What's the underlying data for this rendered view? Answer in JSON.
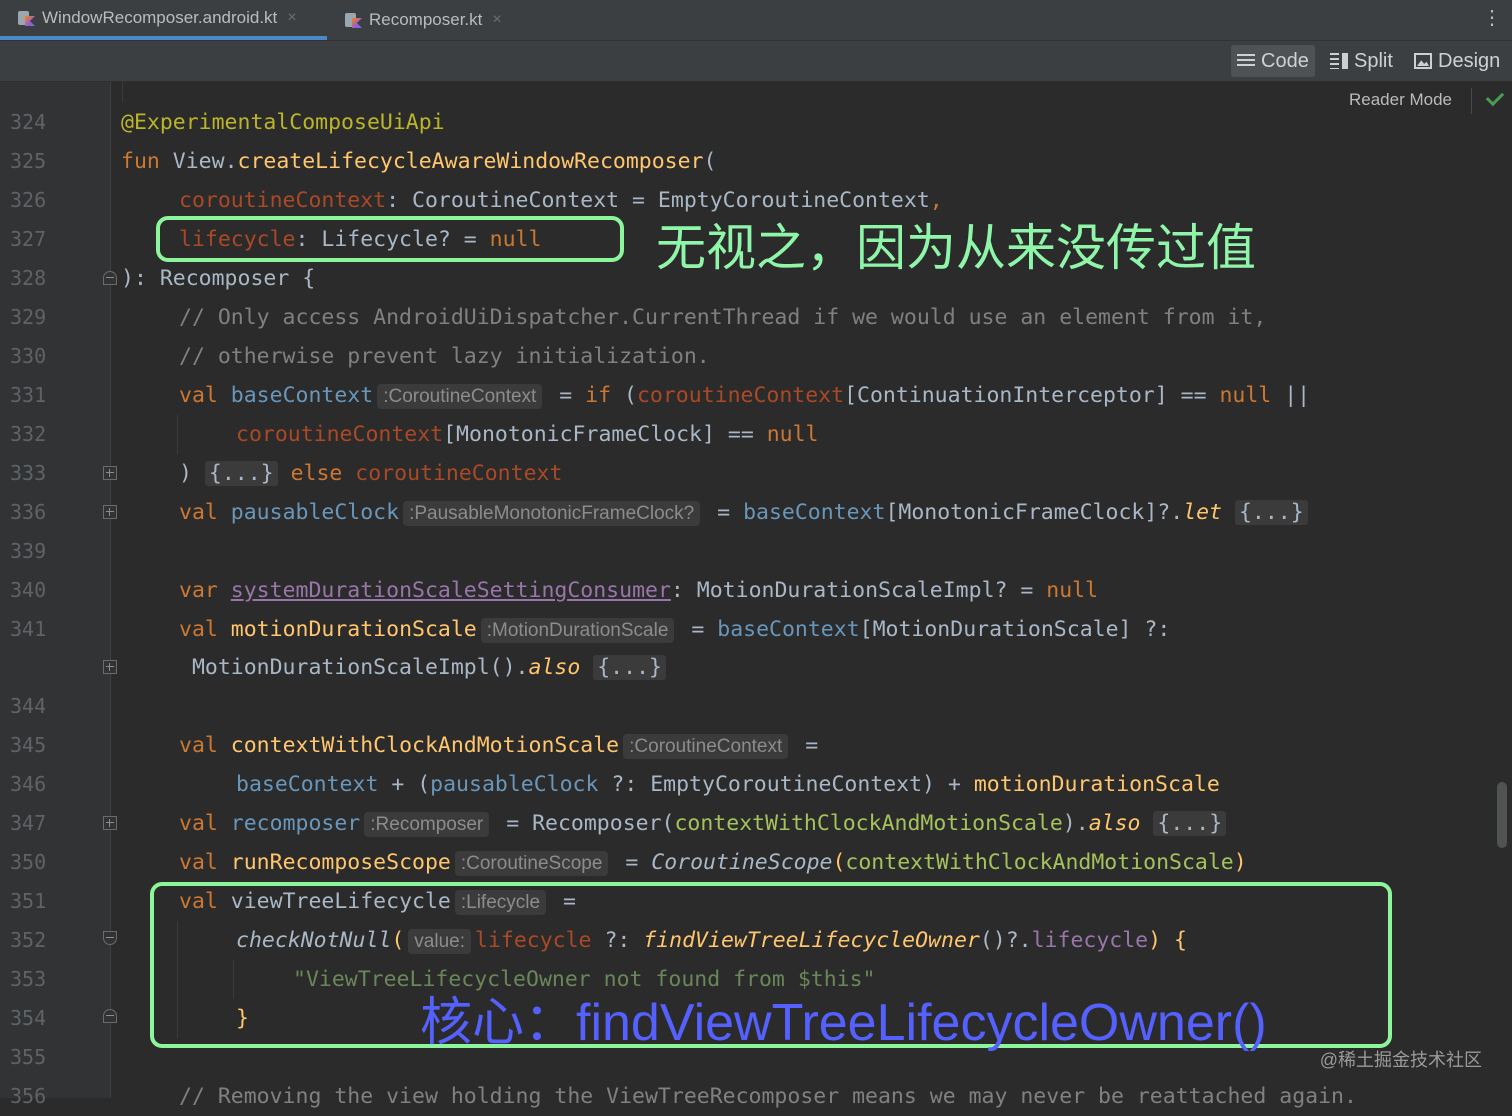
{
  "tabs": [
    {
      "label": "WindowRecomposer.android.kt",
      "active": true
    },
    {
      "label": "Recomposer.kt",
      "active": false
    }
  ],
  "tab_close_glyph": "×",
  "more_glyph": "⋮",
  "view_modes": {
    "code": "Code",
    "split": "Split",
    "design": "Design"
  },
  "reader_mode": "Reader Mode",
  "line_numbers": [
    "324",
    "325",
    "326",
    "327",
    "328",
    "329",
    "330",
    "331",
    "332",
    "333",
    "336",
    "339",
    "340",
    "341",
    "",
    "344",
    "345",
    "346",
    "347",
    "350",
    "351",
    "352",
    "353",
    "354",
    "355",
    "356"
  ],
  "code": {
    "l324": "@ExperimentalComposeUiApi",
    "l325_kw": "fun",
    "l325_recv": " View.",
    "l325_fn": "createLifecycleAwareWindowRecomposer",
    "l325_paren": "(",
    "l326_param": "coroutineContext",
    "l326_type": ": CoroutineContext = EmptyCoroutineContext",
    "l326_comma": ",",
    "l327_param": "lifecycle",
    "l327_type": ": Lifecycle? = ",
    "l327_null": "null",
    "l328": "): Recomposer {",
    "l329": "// Only access AndroidUiDispatcher.CurrentThread if we would use an element from it,",
    "l330": "// otherwise prevent lazy initialization.",
    "l331_val": "val",
    "l331_name": "baseContext",
    "l331_hint": ":CoroutineContext",
    "l331_eq": " = ",
    "l331_if": "if",
    "l331_open": " (",
    "l331_cc": "coroutineContext",
    "l331_rest": "[ContinuationInterceptor] == ",
    "l331_null": "null",
    "l331_or": " ||",
    "l332_cc": "coroutineContext",
    "l332_rest": "[MonotonicFrameClock] == ",
    "l332_null": "null",
    "l333_close": ") ",
    "l333_fold": "{...}",
    "l333_else": " else ",
    "l333_cc": "coroutineContext",
    "l336_val": "val",
    "l336_name": "pausableClock",
    "l336_hint": ":PausableMonotonicFrameClock?",
    "l336_eq": " = ",
    "l336_base": "baseContext",
    "l336_rest": "[MonotonicFrameClock]?.",
    "l336_let": "let",
    "l336_fold": "{...}",
    "l340_var": "var",
    "l340_name": "systemDurationScaleSettingConsumer",
    "l340_rest": ": MotionDurationScaleImpl? = ",
    "l340_null": "null",
    "l341_val": "val",
    "l341_name": "motionDurationScale",
    "l341_hint": ":MotionDurationScale",
    "l341_eq": " = ",
    "l341_base": "baseContext",
    "l341_rest": "[MotionDurationScale] ?:",
    "l342_impl": " MotionDurationScaleImpl().",
    "l342_also": "also",
    "l342_fold": "{...}",
    "l345_val": "val",
    "l345_name": "contextWithClockAndMotionScale",
    "l345_hint": ":CoroutineContext",
    "l345_eq": " =",
    "l346_base": "baseContext",
    "l346_plus": " + (",
    "l346_clock": "pausableClock",
    "l346_rest": " ?: EmptyCoroutineContext) + ",
    "l346_mds": "motionDurationScale",
    "l347_val": "val",
    "l347_name": "recomposer",
    "l347_hint": ":Recomposer",
    "l347_call": " = Recomposer(",
    "l347_arg": "contextWithClockAndMotionScale",
    "l347_close": ").",
    "l347_also": "also",
    "l347_fold": "{...}",
    "l350_val": "val",
    "l350_name": "runRecomposeScope",
    "l350_hint": ":CoroutineScope",
    "l350_eq": " = ",
    "l350_fn": "CoroutineScope",
    "l350_open": "(",
    "l350_arg": "contextWithClockAndMotionScale",
    "l350_close": ")",
    "l351_val": "val",
    "l351_name": "viewTreeLifecycle",
    "l351_hint": ":Lifecycle",
    "l351_eq": " =",
    "l352_fn": "checkNotNull",
    "l352_open": "(",
    "l352_hint": "value:",
    "l352_param": "lifecycle",
    "l352_elvis": " ?: ",
    "l352_find": "findViewTreeLifecycleOwner",
    "l352_call": "()?.",
    "l352_lc": "lifecycle",
    "l352_close": ") {",
    "l353": "\"ViewTreeLifecycleOwner not found from $this\"",
    "l354": "}",
    "l356": "// Removing the view holding the ViewTreeRecomposer means we may never be reattached again."
  },
  "annotations": {
    "green_text": "无视之，因为从来没传过值",
    "blue_text": "核心：findViewTreeLifecycleOwner()",
    "box_color": "#8df59b",
    "blue_color": "#5561ff"
  },
  "watermark": "@稀土掘金技术社区",
  "colors": {
    "keyword": "#cc7832",
    "function": "#ffc66d",
    "comment": "#808080",
    "param": "#aa4926",
    "property": "#9876aa",
    "string": "#6a8759"
  }
}
